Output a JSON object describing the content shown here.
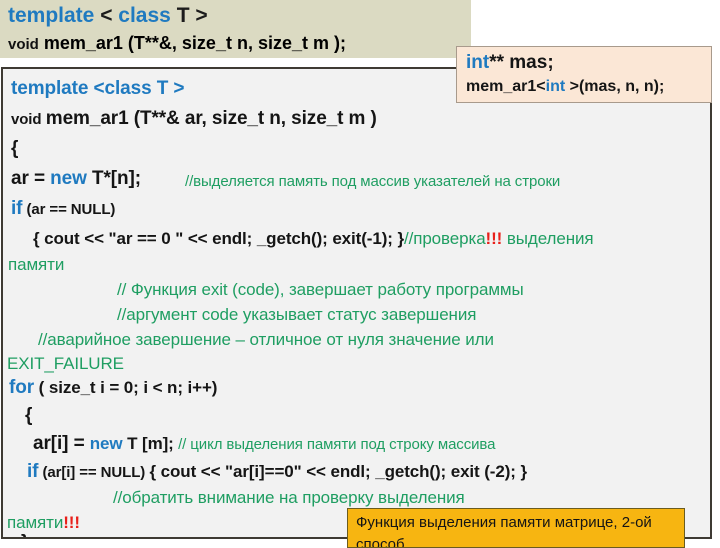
{
  "declaration_box": {
    "line1": {
      "kw_template": "template",
      "rest": " < class T >",
      "kw_class": "class"
    },
    "line1_plain": "template < class T >",
    "line2": "void mem_ar1 (T**&,  size_t  n,  size_t   m );",
    "line2_kw": "void",
    "line2_rest": "mem_ar1 (T**&,  size_t  n,  size_t   m );"
  },
  "callout_int": {
    "line1_kw": "int",
    "line1_rest": "** mas;",
    "line2_pre": "mem_ar1<",
    "line2_kw": "int",
    "line2_post": " >(mas, n, n);"
  },
  "code": {
    "l01_kw": "template",
    "l01_rest": " <class T >",
    "l02_kw": "void",
    "l02_rest": "mem_ar1 (T**& ar, size_t n,  size_t   m )",
    "l03": "{",
    "l04_a": "ar = ",
    "l04_kw": "new",
    "l04_b": " T*[n];",
    "l04_cmt": "//выделяется память под массив  указателей на строки",
    "l05_kw": "if",
    "l05_rest": " (ar == NULL)",
    "l06_code": "{ cout << \"ar == 0 \" << endl; _getch();  exit(-1); }",
    "l06_cmt_a": "//проверка",
    "l06_cmt_bang": "!!!",
    "l06_cmt_b": " выделения",
    "l07_cmt": "памяти",
    "l08_cmt": "// Функция exit (code), завершает работу программы",
    "l09_cmt": "//аргумент code указывает статус завершения",
    "l10_cmt": "//аварийное завершение – отличное от нуля значение или",
    "l11_cmt": "EXIT_FAILURE",
    "l12_kw": "for",
    "l12_rest": " ( size_t  i = 0; i < n; i++)",
    "l13": "{",
    "l14_a": "ar[i] = ",
    "l14_kw": "new",
    "l14_b": " T [m];",
    "l14_cmt": "// цикл выделения памяти под строку массива",
    "l15_kw": "if",
    "l15_cond": " (ar[i] == NULL)",
    "l15_code": "{ cout << \"ar[i]==0\" << endl;  _getch(); exit (-2); }",
    "l16_cmt": "//обратить внимание на проверку выделения",
    "l17_cmt": "памяти",
    "l17_bang": "!!!",
    "l18": "}"
  },
  "callout_note": {
    "line1": "Функция выделения памяти матрице, 2-ой",
    "line2": "способ"
  },
  "colors": {
    "keyword_blue": "#1f7ac0",
    "comment_green": "#1f9e62",
    "bang_red": "#e8201a",
    "decl_bg": "#dbdac2",
    "panel_bg": "#f2f2f2",
    "panel_border": "#3e3a33",
    "callout_int_bg": "#fbe7d6",
    "callout_note_bg": "#f7b511"
  }
}
